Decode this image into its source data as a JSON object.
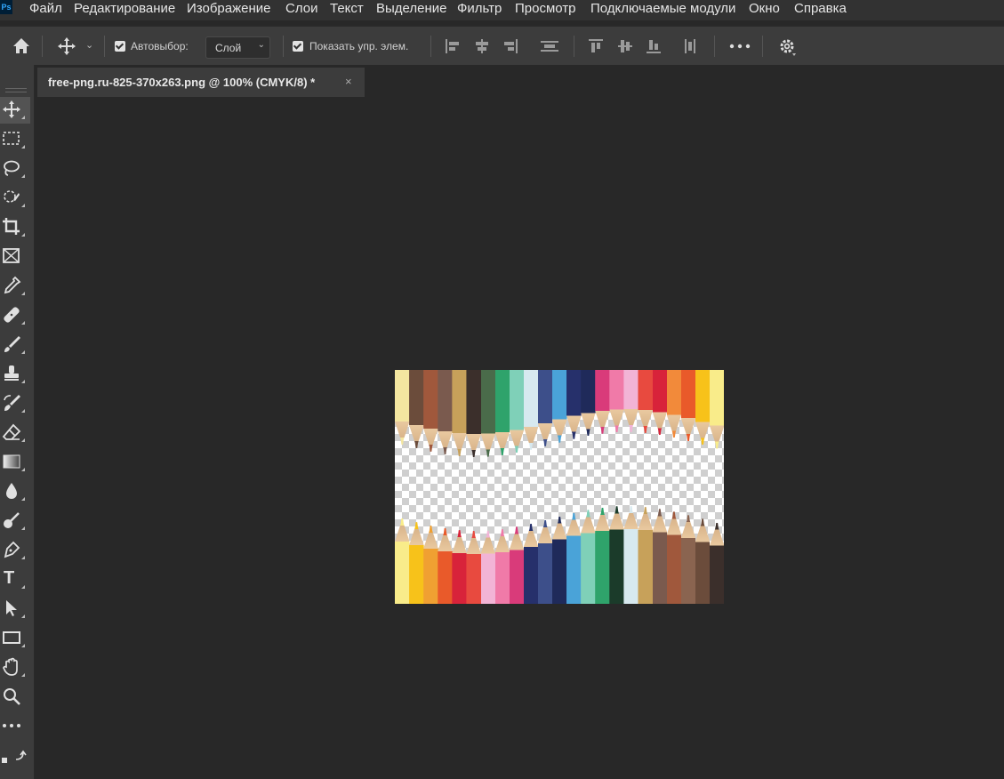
{
  "app": {
    "logo": "Ps"
  },
  "menu": [
    "Файл",
    "Редактирование",
    "Изображение",
    "Слои",
    "Текст",
    "Выделение",
    "Фильтр",
    "Просмотр",
    "Подключаемые модули",
    "Окно",
    "Справка"
  ],
  "options": {
    "autoselect_label": "Автовыбор:",
    "autoselect_checked": true,
    "layer_select_value": "Слой",
    "show_controls_label": "Показать упр. элем.",
    "show_controls_checked": true
  },
  "document": {
    "tab_title": "free-png.ru-825-370x263.png @ 100% (CMYK/8) *",
    "tab_close": "×"
  },
  "tools": {
    "type_glyph": "T"
  },
  "colors": {
    "accent": "#31a8ff",
    "menubar": "#323232",
    "panel": "#3c3c3c",
    "workspace": "#282828",
    "pencils_top": [
      "#f4e6a0",
      "#6b4c3b",
      "#a0583c",
      "#7a5a4e",
      "#c7a15a",
      "#3b2f2b",
      "#4a6b4a",
      "#2fa36b",
      "#7fd0b8",
      "#d7e9ef",
      "#3d4f8a",
      "#4aa3d8",
      "#26306b",
      "#1f2a5a",
      "#d93b7a",
      "#f07aa8",
      "#f2b4d6",
      "#e84a3f",
      "#d8233a",
      "#f28a3a",
      "#e95a2a",
      "#f7c21a",
      "#f9ec8a"
    ],
    "pencils_bottom": [
      "#f9ec8a",
      "#f7c21a",
      "#f0a032",
      "#e95a2a",
      "#d8233a",
      "#e84a3f",
      "#f2b4d6",
      "#f07aa8",
      "#d93b7a",
      "#26306b",
      "#3d4f8a",
      "#1f2a5a",
      "#4aa3d8",
      "#7fd0b8",
      "#2fa36b",
      "#1b3b2a",
      "#d7e9ef",
      "#c7a15a",
      "#7a5a4e",
      "#a0583c",
      "#8a6450",
      "#6b4c3b",
      "#3b2f2b"
    ]
  }
}
